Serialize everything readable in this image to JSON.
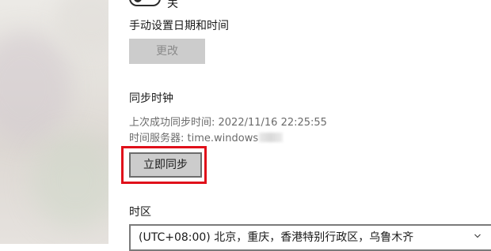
{
  "top": {
    "toggle_state": "关"
  },
  "manual_time": {
    "label": "手动设置日期和时间",
    "change_button": "更改"
  },
  "sync": {
    "heading": "同步时钟",
    "last_sync": "上次成功同步时间: 2022/11/16 22:25:55",
    "time_server": "时间服务器: time.windows",
    "sync_now_button": "立即同步",
    "highlight_color": "#e0101a"
  },
  "timezone": {
    "label": "时区",
    "selected": "(UTC+08:00) 北京，重庆，香港特别行政区，乌鲁木齐"
  }
}
